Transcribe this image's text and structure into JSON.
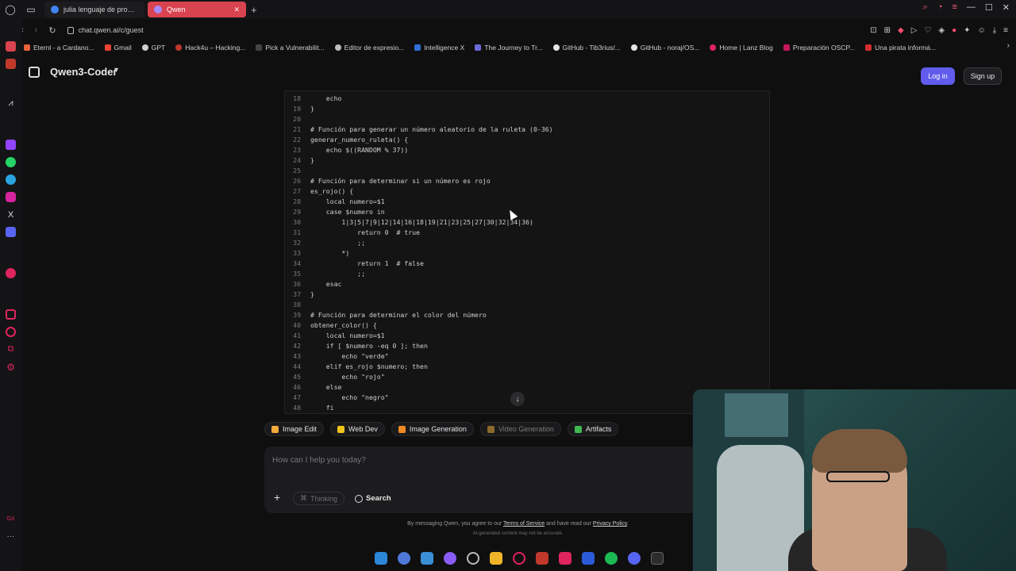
{
  "browser": {
    "tabs": [
      {
        "title": "julia lenguaje de program",
        "active": false
      },
      {
        "title": "Qwen",
        "active": true
      }
    ],
    "url": "chat.qwen.ai/c/guest",
    "bookmarks": [
      "Eternl - a Cardano...",
      "Gmail",
      "GPT",
      "Hack4u – Hacking...",
      "Pick a Vulnerabilit...",
      "Editor de expresio...",
      "Intelligence X",
      "The Journey to Tr...",
      "GitHub - Tib3rius/...",
      "GitHub - noraj/OS...",
      "Home | Lanz Blog",
      "Preparación OSCP...",
      "Una pirata informá..."
    ],
    "accent": "#d9434f"
  },
  "header": {
    "model": "Qwen3-Coder",
    "login": "Log in",
    "signup": "Sign up",
    "login_color": "#615ced"
  },
  "code": {
    "lines": [
      {
        "n": "18",
        "t": "    echo"
      },
      {
        "n": "19",
        "t": "}"
      },
      {
        "n": "20",
        "t": ""
      },
      {
        "n": "21",
        "t": "# Función para generar un número aleatorio de la ruleta (0-36)"
      },
      {
        "n": "22",
        "t": "generar_numero_ruleta() {"
      },
      {
        "n": "23",
        "t": "    echo $((RANDOM % 37))"
      },
      {
        "n": "24",
        "t": "}"
      },
      {
        "n": "25",
        "t": ""
      },
      {
        "n": "26",
        "t": "# Función para determinar si un número es rojo"
      },
      {
        "n": "27",
        "t": "es_rojo() {"
      },
      {
        "n": "28",
        "t": "    local numero=$1"
      },
      {
        "n": "29",
        "t": "    case $numero in"
      },
      {
        "n": "30",
        "t": "        1|3|5|7|9|12|14|16|18|19|21|23|25|27|30|32|34|36)"
      },
      {
        "n": "31",
        "t": "            return 0  # true"
      },
      {
        "n": "32",
        "t": "            ;;"
      },
      {
        "n": "33",
        "t": "        *)"
      },
      {
        "n": "34",
        "t": "            return 1  # false"
      },
      {
        "n": "35",
        "t": "            ;;"
      },
      {
        "n": "36",
        "t": "    esac"
      },
      {
        "n": "37",
        "t": "}"
      },
      {
        "n": "38",
        "t": ""
      },
      {
        "n": "39",
        "t": "# Función para determinar el color del número"
      },
      {
        "n": "40",
        "t": "obtener_color() {"
      },
      {
        "n": "41",
        "t": "    local numero=$1"
      },
      {
        "n": "42",
        "t": "    if [ $numero -eq 0 ]; then"
      },
      {
        "n": "43",
        "t": "        echo \"verde\""
      },
      {
        "n": "44",
        "t": "    elif es_rojo $numero; then"
      },
      {
        "n": "45",
        "t": "        echo \"rojo\""
      },
      {
        "n": "46",
        "t": "    else"
      },
      {
        "n": "47",
        "t": "        echo \"negro\""
      },
      {
        "n": "48",
        "t": "    fi"
      }
    ]
  },
  "tools": [
    {
      "label": "Image Edit",
      "enabled": true,
      "icon": "image-edit-icon"
    },
    {
      "label": "Web Dev",
      "enabled": true,
      "icon": "web-dev-icon"
    },
    {
      "label": "Image Generation",
      "enabled": true,
      "icon": "image-generation-icon"
    },
    {
      "label": "Video Generation",
      "enabled": false,
      "icon": "video-generation-icon"
    },
    {
      "label": "Artifacts",
      "enabled": true,
      "icon": "artifacts-icon"
    }
  ],
  "input": {
    "placeholder": "How can I help you today?",
    "thinking": "Thinking",
    "search": "Search"
  },
  "footer": {
    "prefix": "By messaging Qwen, you agree to our ",
    "terms": "Terms of Service",
    "middle": " and have read our ",
    "privacy": "Privacy Policy",
    "suffix": ".",
    "ai_note": "AI-generated content may not be accurate."
  }
}
